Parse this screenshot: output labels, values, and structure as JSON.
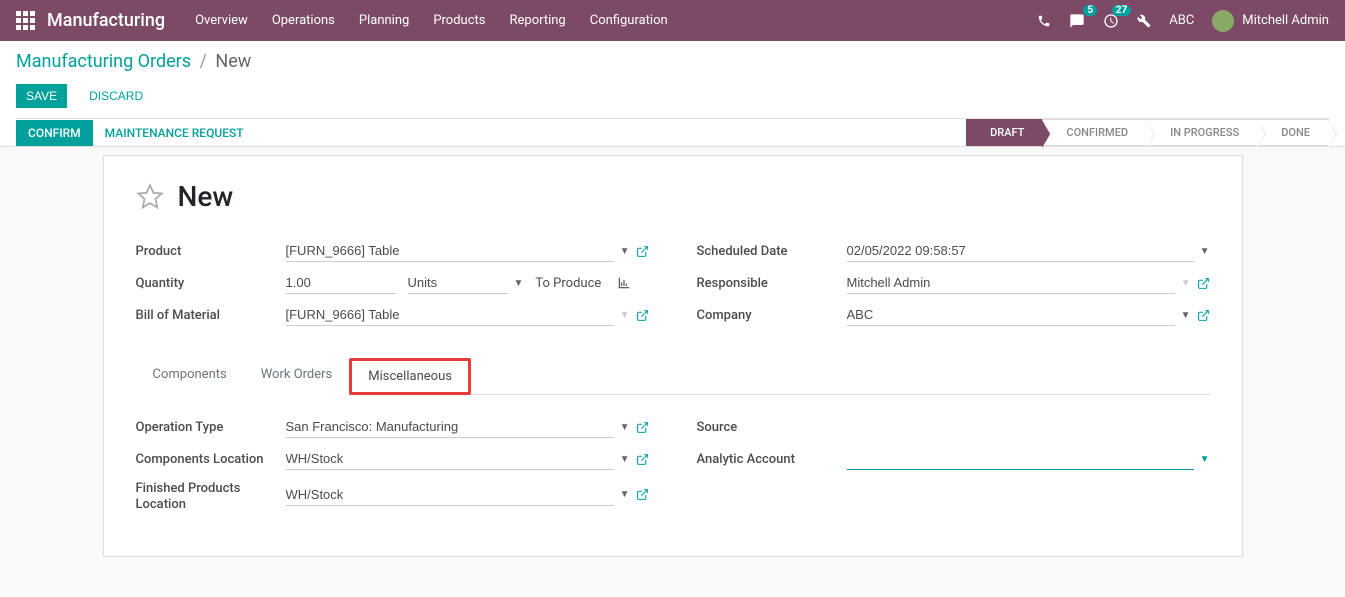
{
  "navbar": {
    "brand": "Manufacturing",
    "menu": [
      "Overview",
      "Operations",
      "Planning",
      "Products",
      "Reporting",
      "Configuration"
    ],
    "chat_badge": "5",
    "activity_badge": "27",
    "company": "ABC",
    "user": "Mitchell Admin"
  },
  "breadcrumb": {
    "parent": "Manufacturing Orders",
    "current": "New"
  },
  "buttons": {
    "save": "Save",
    "discard": "Discard",
    "confirm": "Confirm",
    "maintenance": "Maintenance Request"
  },
  "stages": [
    "Draft",
    "Confirmed",
    "In Progress",
    "Done"
  ],
  "active_stage": "Draft",
  "title": "New",
  "fields": {
    "product_label": "Product",
    "product_value": "[FURN_9666] Table",
    "quantity_label": "Quantity",
    "quantity_value": "1.00",
    "quantity_units": "Units",
    "quantity_suffix": "To Produce",
    "bom_label": "Bill of Material",
    "bom_value": "[FURN_9666] Table",
    "scheduled_label": "Scheduled Date",
    "scheduled_value": "02/05/2022 09:58:57",
    "responsible_label": "Responsible",
    "responsible_value": "Mitchell Admin",
    "company_label": "Company",
    "company_value": "ABC"
  },
  "tabs": [
    "Components",
    "Work Orders",
    "Miscellaneous"
  ],
  "highlighted_tab": "Miscellaneous",
  "misc": {
    "operation_type_label": "Operation Type",
    "operation_type_value": "San Francisco: Manufacturing",
    "components_loc_label": "Components Location",
    "components_loc_value": "WH/Stock",
    "finished_loc_label": "Finished Products Location",
    "finished_loc_value": "WH/Stock",
    "source_label": "Source",
    "source_value": "",
    "analytic_label": "Analytic Account",
    "analytic_value": ""
  }
}
